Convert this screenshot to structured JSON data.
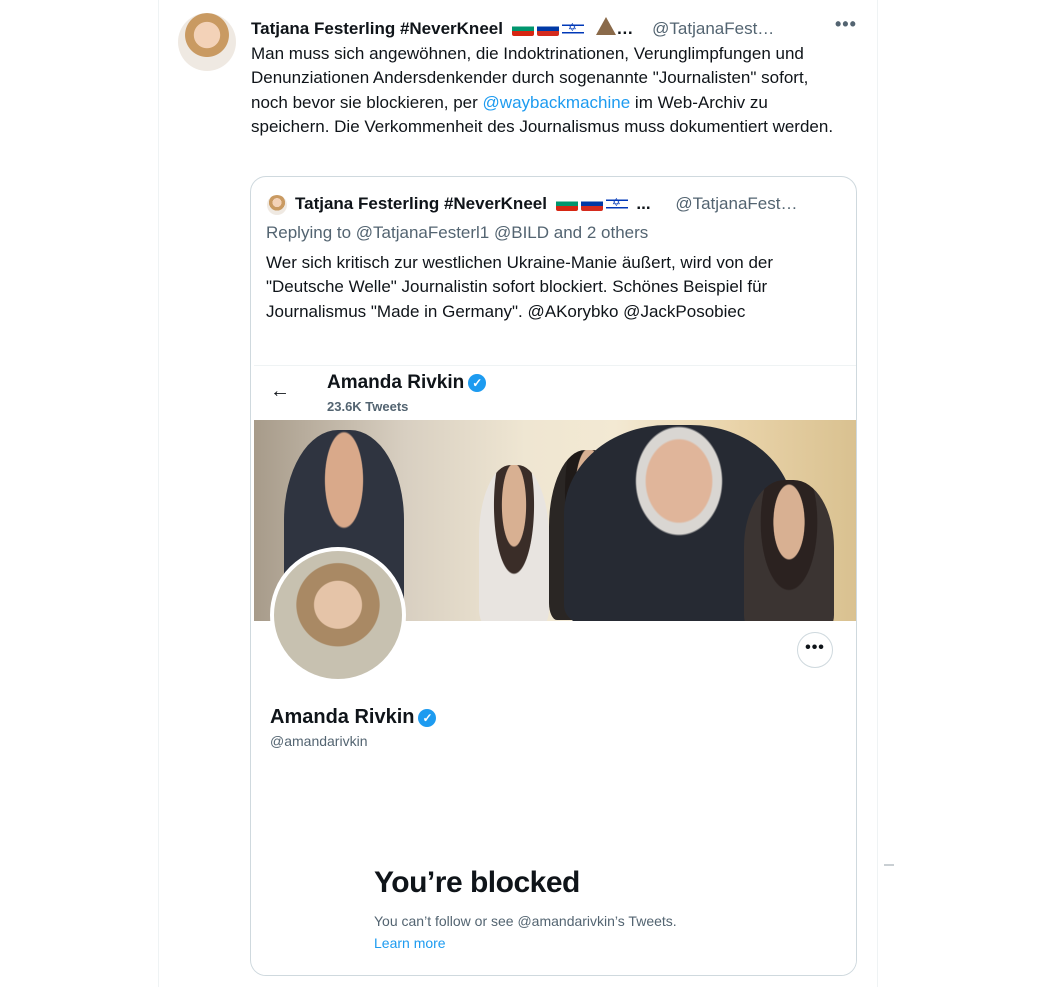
{
  "tweet": {
    "author_name": "Tatjana Festerling #NeverKneel",
    "author_handle": "@TatjanaFest…",
    "ellipsis": "…",
    "text_before_link": "Man muss sich angewöhnen, die Indoktrinationen, Verunglimpfungen und Denunziationen Andersdenkender durch sogenannte \"Journalisten\" sofort, noch bevor sie blockieren, per ",
    "link_text": "@waybackmachine",
    "text_after_link": " im Web-Archiv zu speichern. Die Verkommenheit des Journalismus muss dokumentiert werden.",
    "more_label": "•••",
    "flags": [
      "bulgaria-flag-icon",
      "russia-flag-icon",
      "israel-flag-icon",
      "volcano-icon"
    ]
  },
  "quote": {
    "author_name": "Tatjana Festerling #NeverKneel",
    "author_handle": "@TatjanaFest…",
    "ellipsis": "...",
    "replying": "Replying to @TatjanaFesterl1 @BILD and 2 others",
    "text": "Wer sich kritisch zur westlichen Ukraine-Manie äußert, wird von der \"Deutsche Welle\" Journalistin sofort blockiert. Schönes Beispiel für Journalismus \"Made in Germany\". @AKorybko @JackPosobiec"
  },
  "screenshot": {
    "back_icon": "←",
    "profile_name": "Amanda Rivkin",
    "tweet_count": "23.6K Tweets",
    "verified_icon": "✓",
    "more_label": "•••",
    "profile_handle": "@amandarivkin",
    "blocked_title": "You’re blocked",
    "blocked_subtitle": "You can’t follow or see @amandarivkin’s Tweets.",
    "learn_more": "Learn more"
  },
  "colors": {
    "link": "#1d9bf0",
    "secondary_text": "#536471",
    "border": "#cfd9de"
  }
}
